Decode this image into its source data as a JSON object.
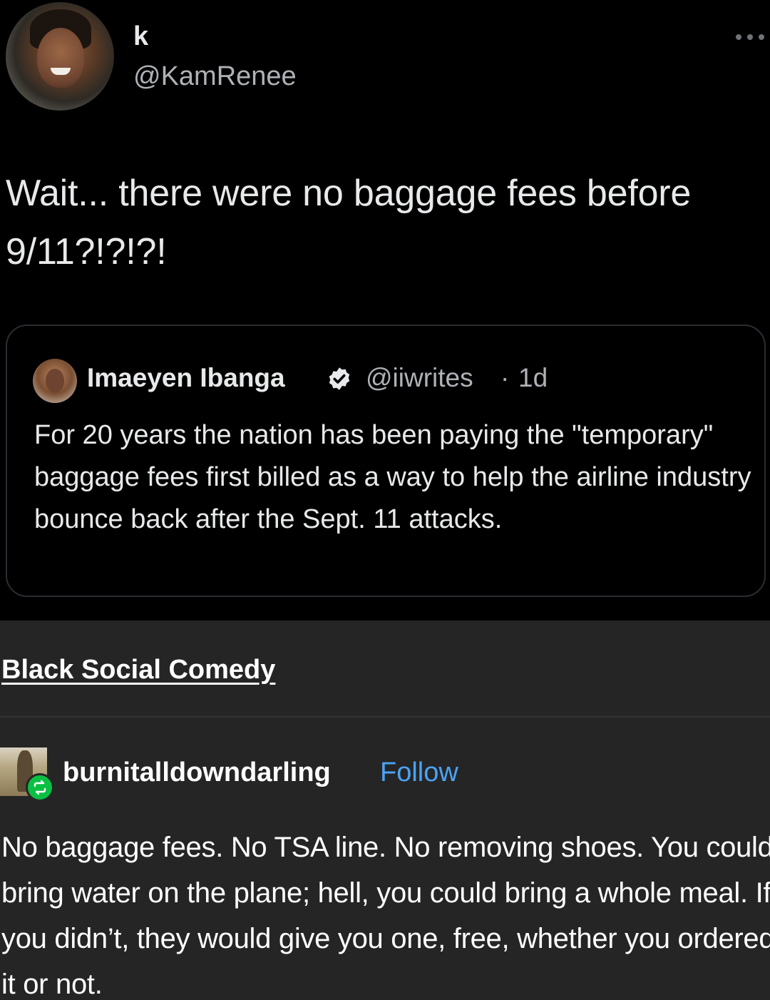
{
  "tweet": {
    "display_name": "k",
    "handle": "@KamRenee",
    "text": "Wait... there were no baggage fees before 9/11?!?!?!"
  },
  "quoted_tweet": {
    "name": "Imaeyen Ibanga",
    "handle": "@iiwrites",
    "separator": "·",
    "time": "1d",
    "text": "For 20 years the nation has been paying the \"temporary\" baggage fees first billed as a way to help the airline industry bounce back after the Sept. 11 attacks."
  },
  "tumblr": {
    "blog_name": "Black Social Comedy",
    "reblogger": "burnitalldowndarling",
    "follow_label": "Follow",
    "post_text": "No baggage fees. No TSA line. No removing shoes. You could bring water on the plane; hell, you could bring a whole meal. If you didn’t, they would give you one, free, whether you ordered it or not."
  },
  "colors": {
    "tweet_bg": "#000000",
    "tumblr_bg": "#252525",
    "follow_link": "#4aa3f5",
    "reblog_badge": "#0ac043"
  },
  "icons": {
    "more": "more-horizontal-icon",
    "verified": "verified-badge-icon",
    "reblog": "reblog-icon"
  }
}
